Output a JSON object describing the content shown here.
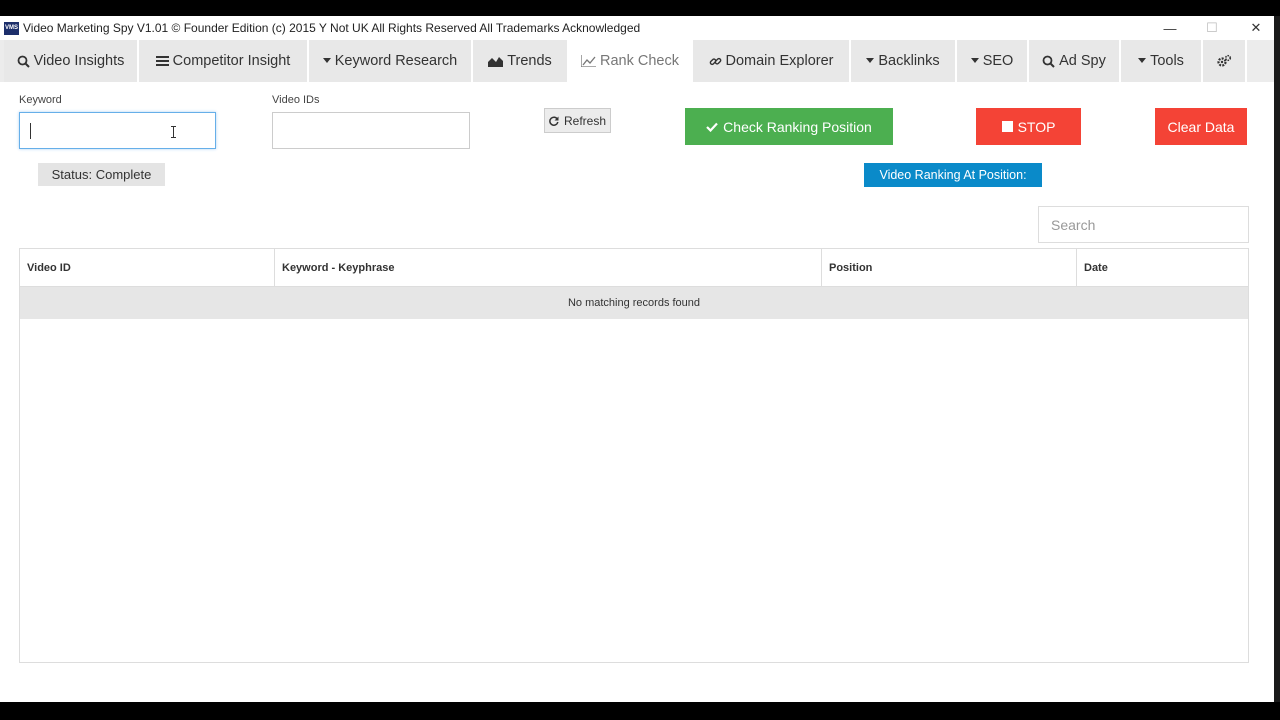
{
  "window": {
    "app_icon_text": "VMS",
    "title": "Video Marketing Spy V1.01  ©  Founder Edition (c) 2015 Y Not UK  All Rights Reserved  All Trademarks Acknowledged",
    "min_glyph": "—",
    "max_glyph": "☐",
    "close_glyph": "✕"
  },
  "tabs": [
    {
      "label": "Video Insights",
      "icon": "search-icon"
    },
    {
      "label": "Competitor Insight",
      "icon": "list-icon"
    },
    {
      "label": "Keyword Research",
      "icon": "caret-down-icon"
    },
    {
      "label": "Trends",
      "icon": "area-chart-icon"
    },
    {
      "label": "Rank Check",
      "icon": "line-chart-icon",
      "active": true
    },
    {
      "label": "Domain Explorer",
      "icon": "link-icon"
    },
    {
      "label": "Backlinks",
      "icon": "caret-down-icon"
    },
    {
      "label": "SEO",
      "icon": "caret-down-icon"
    },
    {
      "label": "Ad Spy",
      "icon": "search-icon"
    },
    {
      "label": "Tools",
      "icon": "caret-down-icon"
    },
    {
      "label": "",
      "icon": "cogs-icon"
    }
  ],
  "form": {
    "keyword_label": "Keyword",
    "keyword_value": "",
    "video_ids_label": "Video IDs",
    "video_ids_value": "",
    "refresh_label": "Refresh",
    "check_label": "Check Ranking Position",
    "stop_label": "STOP",
    "clear_label": "Clear Data",
    "status_text": "Status: Complete",
    "ranking_badge": "Video Ranking At Position:"
  },
  "table": {
    "search_placeholder": "Search",
    "columns": [
      "Video ID",
      "Keyword - Keyphrase",
      "Position",
      "Date"
    ],
    "empty_message": "No matching records found"
  },
  "colors": {
    "check_button": "#4caf50",
    "stop_button": "#f44336",
    "clear_button": "#f44336",
    "ranking_badge": "#0a8ac9"
  }
}
